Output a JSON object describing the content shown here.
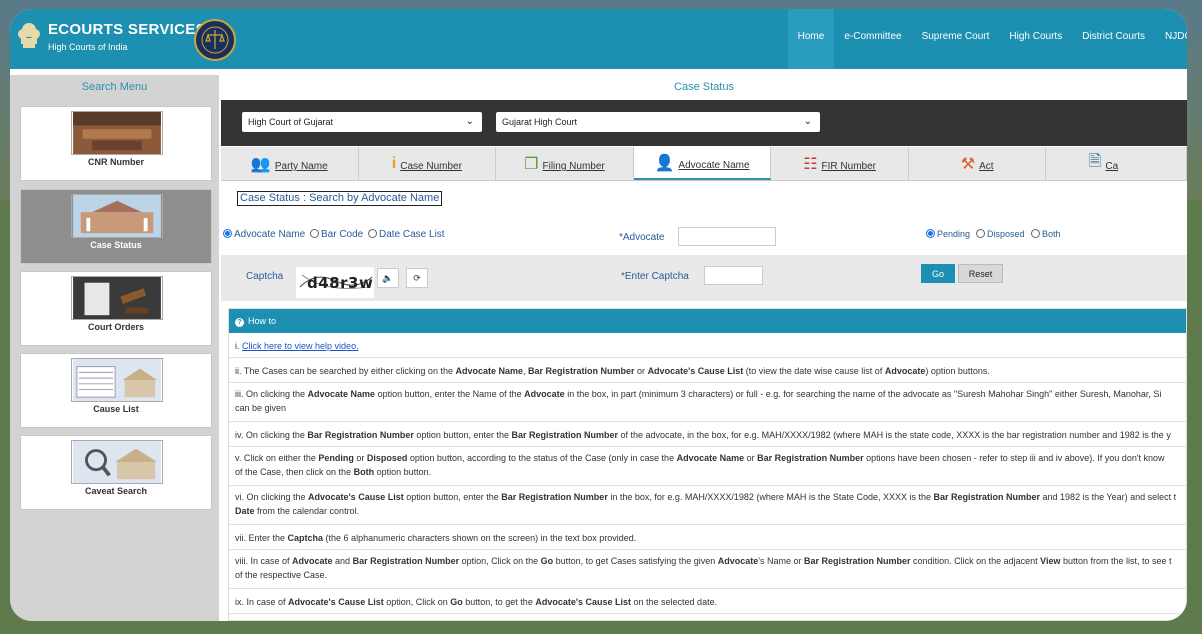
{
  "header": {
    "title": "ECOURTS SERVICES",
    "subtitle": "High Courts of India",
    "nav": [
      "Home",
      "e-Committee",
      "Supreme Court",
      "High Courts",
      "District Courts",
      "NJDG"
    ]
  },
  "sidebar": {
    "title": "Search Menu",
    "items": [
      {
        "label": "CNR Number"
      },
      {
        "label": "Case Status"
      },
      {
        "label": "Court Orders"
      },
      {
        "label": "Cause List"
      },
      {
        "label": "Caveat Search"
      }
    ]
  },
  "main": {
    "heading": "Case Status",
    "selects": {
      "court": "High Court of Gujarat",
      "bench": "Gujarat High Court"
    },
    "tabs": [
      {
        "label": "Party Name",
        "icon": "users-icon"
      },
      {
        "label": "Case Number",
        "icon": "info-icon"
      },
      {
        "label": "Filing Number",
        "icon": "documents-icon"
      },
      {
        "label": "Advocate Name",
        "icon": "user-icon"
      },
      {
        "label": "FIR Number",
        "icon": "list-icon"
      },
      {
        "label": "Act",
        "icon": "gavel-icon"
      },
      {
        "label": "Ca",
        "icon": "file-icon"
      }
    ],
    "form_title": "Case Status : Search by Advocate Name",
    "search_type": {
      "options": [
        "Advocate Name",
        "Bar Code",
        "Date Case List"
      ],
      "selected": "Advocate Name"
    },
    "advocate_label": "*Advocate",
    "advocate_value": "",
    "status": {
      "options": [
        "Pending",
        "Disposed",
        "Both"
      ],
      "selected": "Pending"
    },
    "captcha_label": "Captcha",
    "captcha_text": "d48r3w",
    "enter_captcha_label": "*Enter Captcha",
    "enter_captcha_value": "",
    "go_label": "Go",
    "reset_label": "Reset",
    "howto": {
      "title": "How to",
      "steps": [
        "i. |Click here to view help video.",
        "ii. The Cases can be searched by either clicking on the Advocate Name, Bar Registration Number or Advocate's Cause List (to view the date wise cause list of Advocate) option buttons.",
        "iii. On clicking the Advocate Name option button, enter the Name of the Advocate in the box, in part (minimum 3 characters) or full - e.g. for searching the name of the advocate as \"Suresh Mahohar Singh\" either Suresh, Manohar, Si",
        "can be given",
        "iv. On clicking the Bar Registration Number option button, enter the Bar Registration Number of the advocate, in the box, for e.g. MAH/XXXX/1982 (where MAH is the state code, XXXX is the bar registration number and 1982 is the y",
        "v. Click on either the Pending or Disposed option button, according to the status of the Case (only in case the Advocate Name or Bar Registration Number options have been chosen - refer to step iii and iv above). If you don't know",
        "of the Case, then click on the Both option button.",
        "vi. On clicking the Advocate's Cause List option button, enter the Bar Registration Number in the box, for e.g. MAH/XXXX/1982 (where MAH is the State Code, XXXX is the Bar Registration Number and 1982 is the Year) and select t",
        "Date from the calendar control.",
        "vii. Enter the Captcha (the 6 alphanumeric characters shown on the screen) in the text box provided.",
        "viii. In case of Advocate and Bar Registration Number option, Click on the Go button, to get Cases satisfying the given Advocate's Name or Bar Registration Number condition. Click on the adjacent View button from the list, to see t",
        "of the respective Case.",
        "ix. In case of Advocate's Cause List option, Click on Go button, to get the Advocate's Cause List on the selected date."
      ]
    }
  }
}
